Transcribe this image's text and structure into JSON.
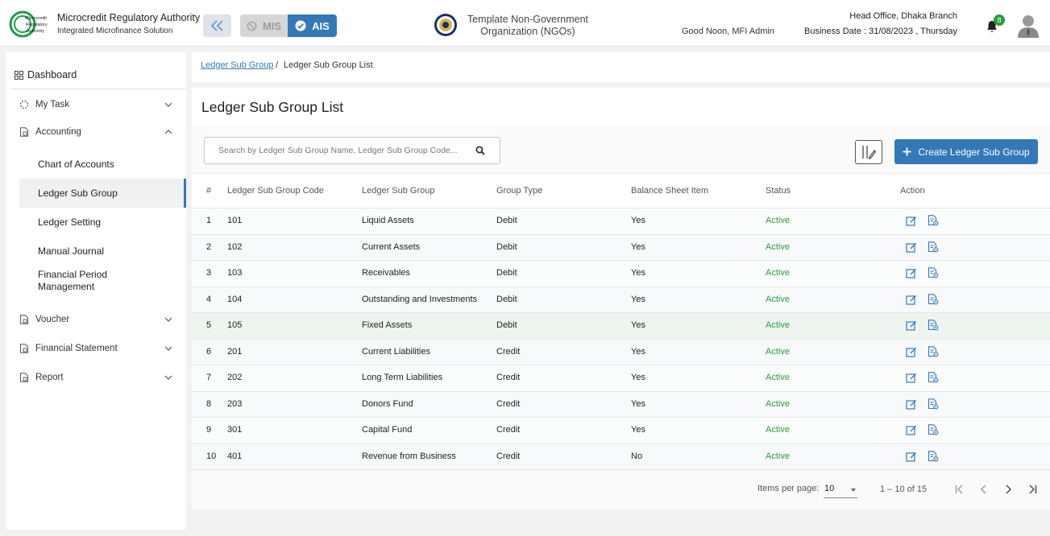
{
  "header": {
    "org_name": "Microcredit Regulatory Authority",
    "org_subtitle": "Integrated Microfinance Solution",
    "logo_text": [
      "Microcredit",
      "Regulatory",
      "Authority"
    ],
    "mis_label": "MIS",
    "ais_label": "AIS",
    "ngo_name": "Template Non-Government Organization (NGOs)",
    "greeting": "Good Noon, MFI Admin",
    "branch": "Head Office, Dhaka Branch",
    "business_date": "Business Date : 31/08/2023 , Thursday",
    "notification_count": "8"
  },
  "sidebar": {
    "dashboard": "Dashboard",
    "my_task": "My Task",
    "accounting": "Accounting",
    "accounting_items": [
      "Chart of Accounts",
      "Ledger Sub Group",
      "Ledger Setting",
      "Manual Journal",
      "Financial Period Management"
    ],
    "voucher": "Voucher",
    "financial_statement": "Financial Statement",
    "report": "Report"
  },
  "breadcrumb": {
    "parent": "Ledger Sub Group",
    "separator": "/",
    "current": "Ledger Sub Group List"
  },
  "main": {
    "title": "Ledger Sub Group List",
    "search_placeholder": "Search by Ledger Sub Group Name, Ledger Sub Group Code...",
    "create_label": "Create Ledger Sub Group"
  },
  "table": {
    "headers": [
      "#",
      "Ledger Sub Group Code",
      "Ledger Sub Group",
      "Group Type",
      "Balance Sheet Item",
      "Status",
      "Action"
    ],
    "rows": [
      [
        "1",
        "101",
        "Liquid Assets",
        "Debit",
        "Yes",
        "Active"
      ],
      [
        "2",
        "102",
        "Current Assets",
        "Debit",
        "Yes",
        "Active"
      ],
      [
        "3",
        "103",
        "Receivables",
        "Debit",
        "Yes",
        "Active"
      ],
      [
        "4",
        "104",
        "Outstanding and Investments",
        "Debit",
        "Yes",
        "Active"
      ],
      [
        "5",
        "105",
        "Fixed Assets",
        "Debit",
        "Yes",
        "Active"
      ],
      [
        "6",
        "201",
        "Current Liabilities",
        "Credit",
        "Yes",
        "Active"
      ],
      [
        "7",
        "202",
        "Long Term Liabilities",
        "Credit",
        "Yes",
        "Active"
      ],
      [
        "8",
        "203",
        "Donors Fund",
        "Credit",
        "Yes",
        "Active"
      ],
      [
        "9",
        "301",
        "Capital Fund",
        "Credit",
        "Yes",
        "Active"
      ],
      [
        "10",
        "401",
        "Revenue from Business",
        "Credit",
        "No",
        "Active"
      ]
    ]
  },
  "pagination": {
    "items_per_page_label": "Items per page:",
    "items_per_page": "10",
    "range": "1 – 10 of 15"
  },
  "colors": {
    "primary": "#3478b8",
    "active_status": "#2a9d3a",
    "badge": "#2a9d3a"
  }
}
